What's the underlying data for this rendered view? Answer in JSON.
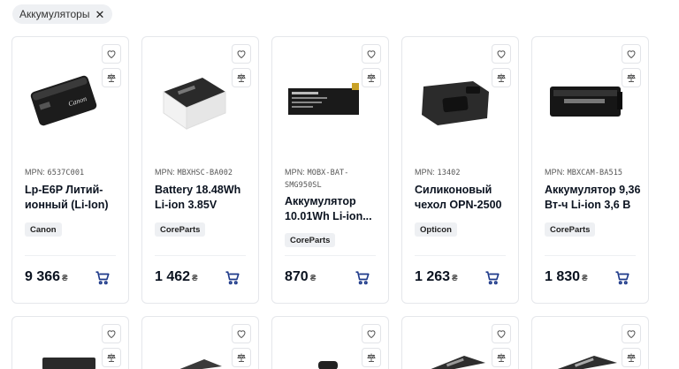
{
  "filter": {
    "label": "Аккумуляторы",
    "remove": "✕"
  },
  "products": [
    {
      "mpn_label": "MPN:",
      "mpn": "6537C001",
      "title": "Lp-E6P Литий-ионный (Li-Ion)",
      "brand": "Canon",
      "price": "9 366",
      "currency": "₴",
      "image": "camera-battery"
    },
    {
      "mpn_label": "MPN:",
      "mpn": "MBXHSC-BA002",
      "title": "Battery 18.48Wh Li-ion 3.85V",
      "brand": "CoreParts",
      "price": "1 462",
      "currency": "₴",
      "image": "battery-pack"
    },
    {
      "mpn_label": "MPN:",
      "mpn": "MOBX-BAT-SMG950SL",
      "title": "Аккумулятор 10.01Wh Li-ion...",
      "brand": "CoreParts",
      "price": "870",
      "currency": "₴",
      "image": "phone-battery"
    },
    {
      "mpn_label": "MPN:",
      "mpn": "13402",
      "title": "Силиконовый чехол OPN-2500",
      "brand": "Opticon",
      "price": "1 263",
      "currency": "₴",
      "image": "silicone-case"
    },
    {
      "mpn_label": "MPN:",
      "mpn": "MBXCAM-BA515",
      "title": "Аккумулятор 9,36 Вт-ч Li-ion 3,6 В",
      "brand": "CoreParts",
      "price": "1 830",
      "currency": "₴",
      "image": "camcorder-battery"
    }
  ],
  "icons": {
    "favorite": "heart-icon",
    "compare": "scales-icon",
    "cart": "cart-icon"
  },
  "colors": {
    "accent": "#1e3a8a",
    "chip_bg": "#eef0f3",
    "border": "#e5e7eb"
  }
}
